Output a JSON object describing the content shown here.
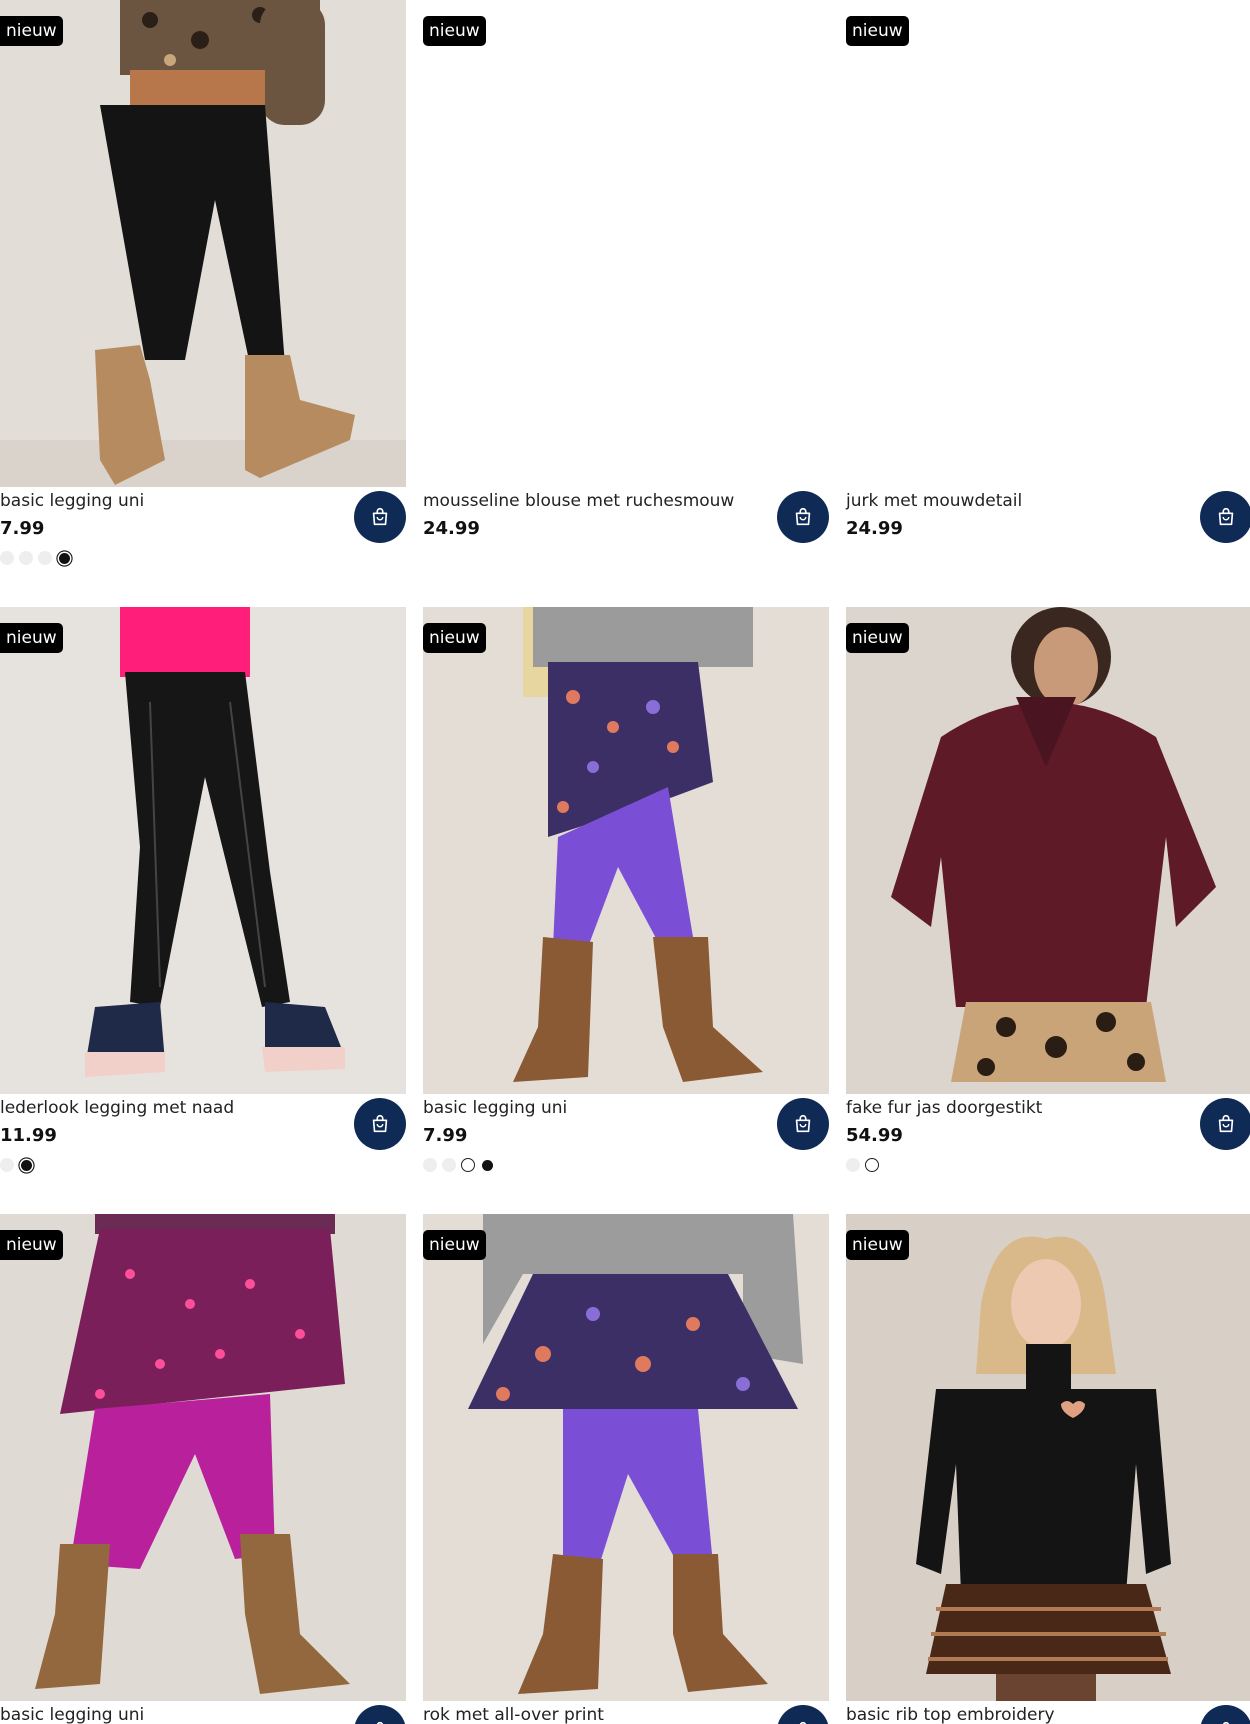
{
  "products": [
    {
      "badge": "nieuw",
      "name": "basic legging uni",
      "price": "7.99",
      "image": "girl-black-leggings-leopard-sweater"
    },
    {
      "badge": "nieuw",
      "name": "mousseline blouse met ruchesmouw",
      "price": "24.99",
      "image": "blank"
    },
    {
      "badge": "nieuw",
      "name": "jurk met mouwdetail",
      "price": "24.99",
      "image": "blank"
    },
    {
      "badge": "nieuw",
      "name": "lederlook legging met naad",
      "price": "11.99",
      "image": "girl-leather-leggings-pink-top"
    },
    {
      "badge": "nieuw",
      "name": "basic legging uni",
      "price": "7.99",
      "image": "girl-purple-leggings-floral-skirt"
    },
    {
      "badge": "nieuw",
      "name": "fake fur jas doorgestikt",
      "price": "54.99",
      "image": "girl-burgundy-fur-jacket"
    },
    {
      "badge": "nieuw",
      "name": "basic legging uni",
      "price": "",
      "image": "girl-magenta-leggings-pink-skirt"
    },
    {
      "badge": "nieuw",
      "name": "rok met all-over print",
      "price": "",
      "image": "girl-floral-skirt-purple-leggings"
    },
    {
      "badge": "nieuw",
      "name": "basic rib top embroidery",
      "price": "",
      "image": "girl-black-rib-top"
    }
  ],
  "icons": {
    "cart": "shopping-bag-icon"
  },
  "colors": {
    "cart_button": "#0f2a55",
    "badge": "#000000"
  }
}
